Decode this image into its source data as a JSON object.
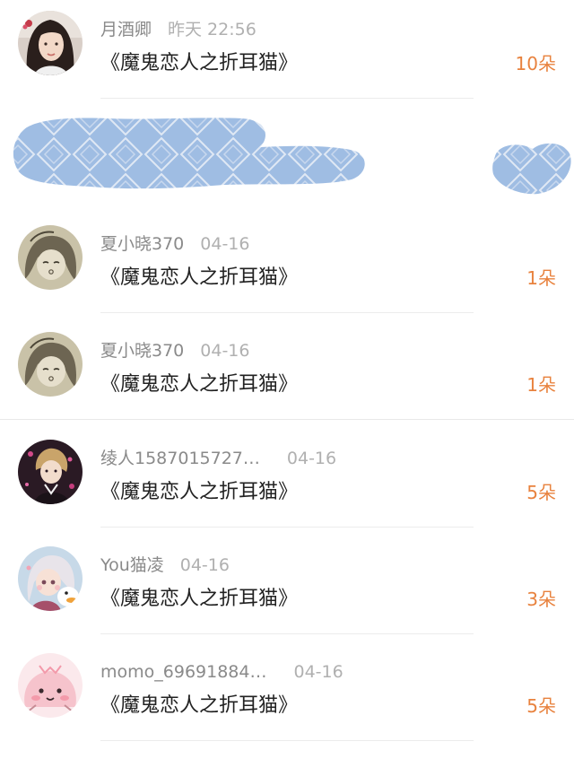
{
  "items": [
    {
      "name": "月酒卿",
      "time": "昨天 22:56",
      "title": "《魔鬼恋人之折耳猫》",
      "count": "10朵",
      "avatar": "avatar-woman-photo"
    },
    {
      "name": "夏小晓370",
      "time": "04-16",
      "title": "《魔鬼恋人之折耳猫》",
      "count": "1朵",
      "avatar": "avatar-anime-sketch"
    },
    {
      "name": "夏小晓370",
      "time": "04-16",
      "title": "《魔鬼恋人之折耳猫》",
      "count": "1朵",
      "avatar": "avatar-anime-sketch"
    },
    {
      "name": "绫人1587015727…",
      "time": "04-16",
      "title": "《魔鬼恋人之折耳猫》",
      "count": "5朵",
      "avatar": "avatar-anime-boy-dark"
    },
    {
      "name": "You猫凌",
      "time": "04-16",
      "title": "《魔鬼恋人之折耳猫》",
      "count": "3朵",
      "avatar": "avatar-anime-girl-duck"
    },
    {
      "name": "momo_69691884…",
      "time": "04-16",
      "title": "《魔鬼恋人之折耳猫》",
      "count": "5朵",
      "avatar": "avatar-pink-blob"
    }
  ],
  "colors": {
    "count": "#e8823e",
    "name": "#8a8a8a",
    "time": "#b0b0b0",
    "title": "#222222",
    "redaction": "#9fbde3"
  }
}
